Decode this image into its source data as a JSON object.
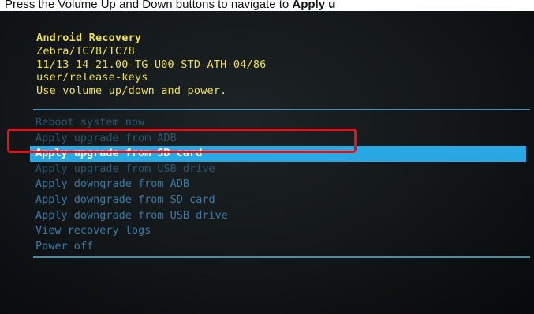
{
  "caption": {
    "prefix": "Press the Volume Up and Down buttons to navigate to ",
    "bold": "Apply u"
  },
  "recovery": {
    "title": "Android Recovery",
    "lines": [
      "Zebra/TC78/TC78",
      "11/13-14-21.00-TG-U00-STD-ATH-04/86",
      "user/release-keys",
      "Use volume up/down and power."
    ]
  },
  "menu": {
    "items": [
      "Reboot system now",
      "Apply upgrade from ADB",
      "Apply upgrade from SD card",
      "Apply upgrade from USB drive",
      "Apply downgrade from ADB",
      "Apply downgrade from SD card",
      "Apply downgrade from USB drive",
      "View recovery logs",
      "Power off"
    ],
    "selected_index": 2
  },
  "colors": {
    "header_text": "#f0e050",
    "menu_text": "#3e86b5",
    "selection_bg": "#2aa8e4",
    "highlight_box": "#e0141c"
  }
}
